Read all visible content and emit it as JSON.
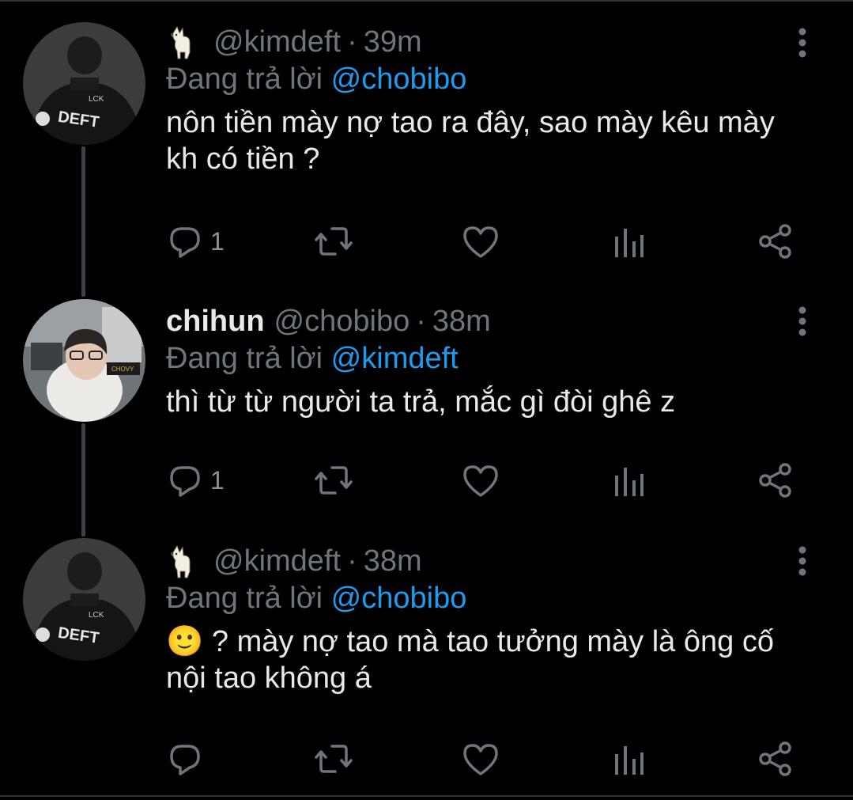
{
  "colors": {
    "background": "#000000",
    "text_primary": "#e7e9ea",
    "text_secondary": "#6e767d",
    "mention": "#1d9bf0",
    "thread_line": "#3d4248"
  },
  "tweets": [
    {
      "emoji_icon": "llama-icon",
      "display_name": "",
      "handle": "@kimdeft",
      "separator": "·",
      "time": "39m",
      "reply_prefix": "Đang trả lời",
      "reply_to": "@chobibo",
      "body_emoji": "",
      "text": "nôn tiền mày nợ tao ra đây, sao mày kêu mày kh có tiền ?",
      "avatar_label": "DEFT",
      "reply_count": "1",
      "icons": [
        "reply-icon",
        "retweet-icon",
        "like-icon",
        "analytics-icon",
        "share-icon"
      ]
    },
    {
      "emoji_icon": "",
      "display_name": "chihun",
      "handle": "@chobibo",
      "separator": "·",
      "time": "38m",
      "reply_prefix": "Đang trả lời",
      "reply_to": "@kimdeft",
      "body_emoji": "",
      "text": "thì từ từ người ta trả, mắc gì đòi ghê z",
      "avatar_label": "CHOVY",
      "reply_count": "1",
      "icons": [
        "reply-icon",
        "retweet-icon",
        "like-icon",
        "analytics-icon",
        "share-icon"
      ]
    },
    {
      "emoji_icon": "llama-icon",
      "display_name": "",
      "handle": "@kimdeft",
      "separator": "·",
      "time": "38m",
      "reply_prefix": "Đang trả lời",
      "reply_to": "@chobibo",
      "body_emoji": "🙂",
      "text": "? mày nợ tao mà tao tưởng mày là ông cố nội tao không á",
      "avatar_label": "DEFT",
      "reply_count": "",
      "icons": [
        "reply-icon",
        "retweet-icon",
        "like-icon",
        "analytics-icon",
        "share-icon"
      ]
    }
  ]
}
